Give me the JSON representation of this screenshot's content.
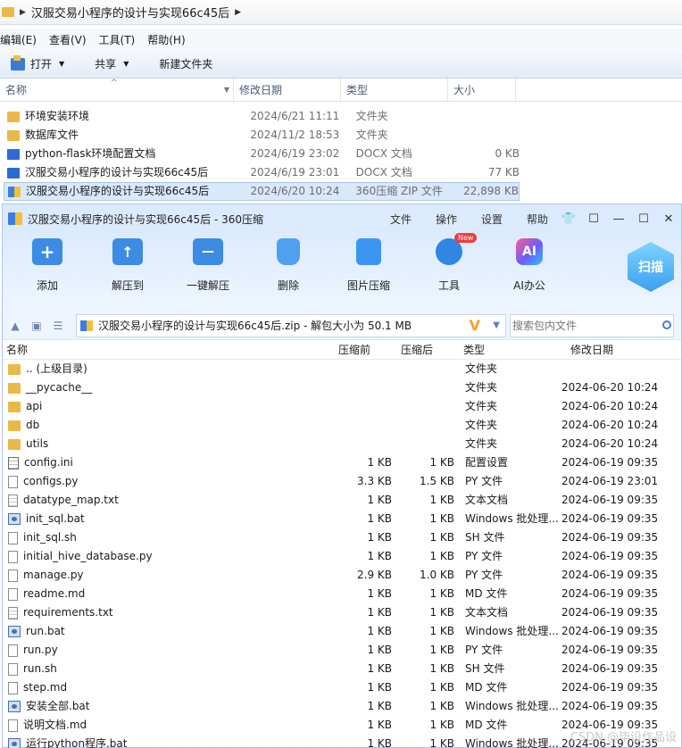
{
  "explorer": {
    "breadcrumb": "汉服交易小程序的设计与实现66c45后",
    "menu": [
      "编辑(E)",
      "查看(V)",
      "工具(T)",
      "帮助(H)"
    ],
    "toolbar": {
      "open": "打开",
      "share": "共享",
      "new_folder": "新建文件夹"
    },
    "columns": {
      "name": "名称",
      "modified": "修改日期",
      "type": "类型",
      "size": "大小"
    },
    "files": [
      {
        "icon": "folder-icon",
        "name": "环境安装环境",
        "date": "2024/6/21 11:11",
        "type": "文件夹",
        "size": ""
      },
      {
        "icon": "folder-icon",
        "name": "数据库文件",
        "date": "2024/11/2 18:53",
        "type": "文件夹",
        "size": ""
      },
      {
        "icon": "docx-icon",
        "name": "python-flask环境配置文档",
        "date": "2024/6/19 23:02",
        "type": "DOCX 文档",
        "size": "0 KB"
      },
      {
        "icon": "docx-icon",
        "name": "汉服交易小程序的设计与实现66c45后",
        "date": "2024/6/19 23:01",
        "type": "DOCX 文档",
        "size": "77 KB"
      },
      {
        "icon": "zip-icon",
        "name": "汉服交易小程序的设计与实现66c45后",
        "date": "2024/6/20 10:24",
        "type": "360压缩 ZIP 文件",
        "size": "22,898 KB"
      }
    ]
  },
  "zip": {
    "title": "汉服交易小程序的设计与实现66c45后 - 360压缩",
    "menu": [
      "文件",
      "操作",
      "设置",
      "帮助"
    ],
    "tools": [
      {
        "label": "添加",
        "icon": "add-icon"
      },
      {
        "label": "解压到",
        "icon": "extract-icon"
      },
      {
        "label": "一键解压",
        "icon": "one-click-extract-icon"
      },
      {
        "label": "删除",
        "icon": "delete-icon"
      },
      {
        "label": "图片压缩",
        "icon": "image-compress-icon"
      },
      {
        "label": "工具",
        "icon": "tools-icon"
      },
      {
        "label": "AI办公",
        "icon": "ai-office-icon"
      }
    ],
    "new_badge": "New",
    "scan_label": "扫描",
    "path": "汉服交易小程序的设计与实现66c45后.zip - 解包大小为 50.1 MB",
    "search_placeholder": "搜索包内文件",
    "columns": {
      "name": "名称",
      "compressed": "压缩前",
      "original": "压缩后",
      "type": "类型",
      "modified": "修改日期"
    },
    "files": [
      {
        "kind": "folder",
        "name": ".. (上级目录)",
        "comp": "",
        "orig": "",
        "type": "文件夹",
        "date": ""
      },
      {
        "kind": "folder",
        "name": "__pycache__",
        "comp": "",
        "orig": "",
        "type": "文件夹",
        "date": "2024-06-20 10:24"
      },
      {
        "kind": "folder",
        "name": "api",
        "comp": "",
        "orig": "",
        "type": "文件夹",
        "date": "2024-06-20 10:24"
      },
      {
        "kind": "folder",
        "name": "db",
        "comp": "",
        "orig": "",
        "type": "文件夹",
        "date": "2024-06-20 10:24"
      },
      {
        "kind": "folder",
        "name": "utils",
        "comp": "",
        "orig": "",
        "type": "文件夹",
        "date": "2024-06-20 10:24"
      },
      {
        "kind": "cfg",
        "name": "config.ini",
        "comp": "1 KB",
        "orig": "1 KB",
        "type": "配置设置",
        "date": "2024-06-19 09:35"
      },
      {
        "kind": "file",
        "name": "configs.py",
        "comp": "3.3 KB",
        "orig": "1.5 KB",
        "type": "PY 文件",
        "date": "2024-06-19 23:01"
      },
      {
        "kind": "doc",
        "name": "datatype_map.txt",
        "comp": "1 KB",
        "orig": "1 KB",
        "type": "文本文档",
        "date": "2024-06-19 09:35"
      },
      {
        "kind": "bat",
        "name": "init_sql.bat",
        "comp": "1 KB",
        "orig": "1 KB",
        "type": "Windows 批处理...",
        "date": "2024-06-19 09:35"
      },
      {
        "kind": "file",
        "name": "init_sql.sh",
        "comp": "1 KB",
        "orig": "1 KB",
        "type": "SH 文件",
        "date": "2024-06-19 09:35"
      },
      {
        "kind": "file",
        "name": "initial_hive_database.py",
        "comp": "1 KB",
        "orig": "1 KB",
        "type": "PY 文件",
        "date": "2024-06-19 09:35"
      },
      {
        "kind": "file",
        "name": "manage.py",
        "comp": "2.9 KB",
        "orig": "1.0 KB",
        "type": "PY 文件",
        "date": "2024-06-19 09:35"
      },
      {
        "kind": "file",
        "name": "readme.md",
        "comp": "1 KB",
        "orig": "1 KB",
        "type": "MD 文件",
        "date": "2024-06-19 09:35"
      },
      {
        "kind": "doc",
        "name": "requirements.txt",
        "comp": "1 KB",
        "orig": "1 KB",
        "type": "文本文档",
        "date": "2024-06-19 09:35"
      },
      {
        "kind": "bat",
        "name": "run.bat",
        "comp": "1 KB",
        "orig": "1 KB",
        "type": "Windows 批处理...",
        "date": "2024-06-19 09:35"
      },
      {
        "kind": "file",
        "name": "run.py",
        "comp": "1 KB",
        "orig": "1 KB",
        "type": "PY 文件",
        "date": "2024-06-19 09:35"
      },
      {
        "kind": "file",
        "name": "run.sh",
        "comp": "1 KB",
        "orig": "1 KB",
        "type": "SH 文件",
        "date": "2024-06-19 09:35"
      },
      {
        "kind": "file",
        "name": "step.md",
        "comp": "1 KB",
        "orig": "1 KB",
        "type": "MD 文件",
        "date": "2024-06-19 09:35"
      },
      {
        "kind": "bat",
        "name": "安装全部.bat",
        "comp": "1 KB",
        "orig": "1 KB",
        "type": "Windows 批处理...",
        "date": "2024-06-19 09:35"
      },
      {
        "kind": "file",
        "name": "说明文档.md",
        "comp": "1 KB",
        "orig": "1 KB",
        "type": "MD 文件",
        "date": "2024-06-19 09:35"
      },
      {
        "kind": "bat",
        "name": "运行python程序.bat",
        "comp": "1 KB",
        "orig": "1 KB",
        "type": "Windows 批处理...",
        "date": "2024-06-19 09:35"
      }
    ]
  },
  "watermark": "CSDN @毕设作品设"
}
